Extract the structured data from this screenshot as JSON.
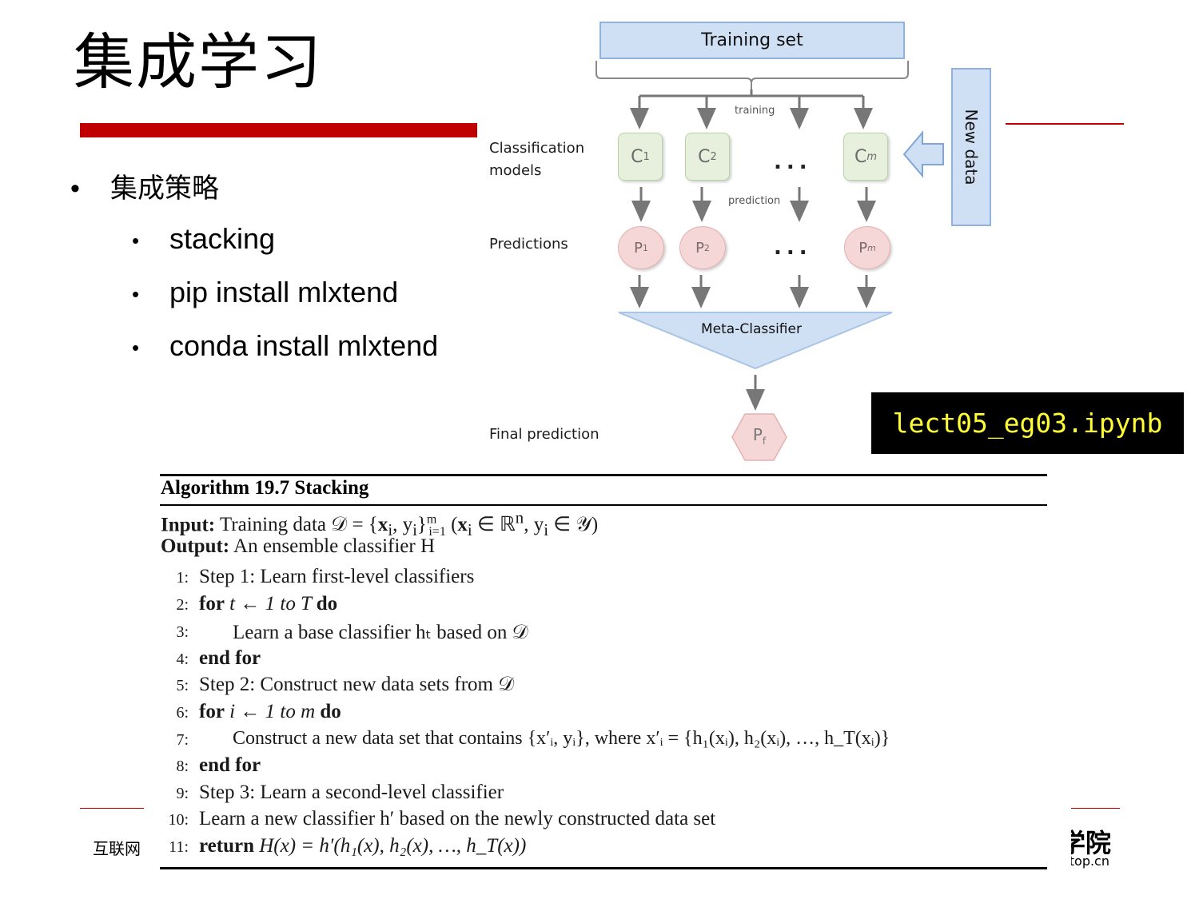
{
  "slide": {
    "title": "集成学习",
    "bullets": {
      "level1": "集成策略",
      "level2": [
        "stacking",
        "pip install mlxtend",
        "conda install mlxtend"
      ]
    }
  },
  "diagram": {
    "training_set": "Training set",
    "new_data": "New data",
    "training_label": "training",
    "prediction_label": "prediction",
    "row_labels": {
      "classification_models": [
        "Classification",
        "models"
      ],
      "predictions": "Predictions",
      "final_prediction": "Final prediction"
    },
    "classifiers": [
      {
        "base": "C",
        "sub": "1"
      },
      {
        "base": "C",
        "sub": "2"
      },
      {
        "base": "C",
        "sub": "m"
      }
    ],
    "predictions": [
      {
        "base": "P",
        "sub": "1"
      },
      {
        "base": "P",
        "sub": "2"
      },
      {
        "base": "P",
        "sub": "m"
      }
    ],
    "ellipsis": "...",
    "meta_classifier": "Meta-Classifier",
    "final": {
      "base": "P",
      "sub": "f"
    }
  },
  "code_tag": "lect05_eg03.ipynb",
  "algorithm": {
    "title": "Algorithm 19.7 Stacking",
    "input_label": "Input:",
    "output_label": "Output:",
    "output_text": " An ensemble classifier H",
    "lines": [
      {
        "n": "1:",
        "indent": false,
        "text": "Step 1: Learn first-level classifiers"
      },
      {
        "n": "2:",
        "indent": false,
        "text": ""
      },
      {
        "n": "3:",
        "indent": true,
        "text": "Learn a base classifier hₜ based on 𝒟"
      },
      {
        "n": "4:",
        "indent": false,
        "text": ""
      },
      {
        "n": "5:",
        "indent": false,
        "text": "Step 2: Construct new data sets from 𝒟"
      },
      {
        "n": "6:",
        "indent": false,
        "text": ""
      },
      {
        "n": "7:",
        "indent": true,
        "text": "Construct a new data set that contains {x′ᵢ, yᵢ}, where x′ᵢ = {h₁(xᵢ), h₂(xᵢ), …, h_T(xᵢ)}"
      },
      {
        "n": "8:",
        "indent": false,
        "text": ""
      },
      {
        "n": "9:",
        "indent": false,
        "text": "Step 3: Learn a second-level classifier"
      },
      {
        "n": "10:",
        "indent": false,
        "text": "Learn a new classifier h′ based on the newly constructed data set"
      },
      {
        "n": "11:",
        "indent": false,
        "text": ""
      }
    ],
    "keywords": {
      "for": "for",
      "do": "do",
      "end_for": "end for",
      "return": "return"
    },
    "line2_rest": " t ← 1 to T ",
    "line6_rest": " i ← 1 to m ",
    "line11_rest": " H(x) = h′(h₁(x), h₂(x), …, h_T(x))"
  },
  "footer": {
    "left": "互联网",
    "brand": "学院",
    "url": "top.cn"
  },
  "colors": {
    "accent_red": "#c00000",
    "box_blue": "#cfe0f4",
    "box_green": "#e6f0dd",
    "circle_pink": "#f5d7d7",
    "code_yellow": "#ffff33"
  }
}
